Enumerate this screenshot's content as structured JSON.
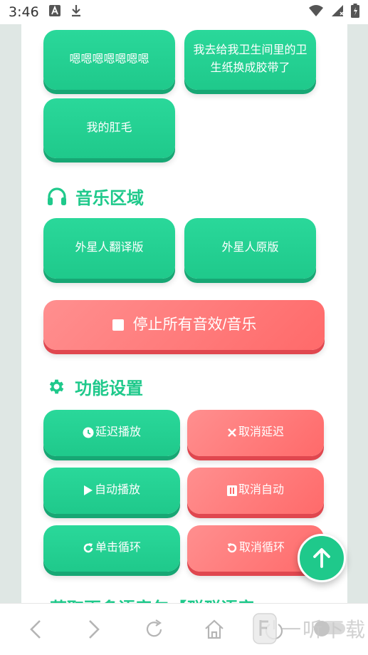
{
  "status_bar": {
    "time": "3:46"
  },
  "top_buttons": [
    {
      "label": "嗯嗯嗯嗯嗯嗯嗯"
    },
    {
      "label": "我去给我卫生间里的卫生纸换成胶带了"
    },
    {
      "label": "我的肛毛"
    }
  ],
  "music_section": {
    "title": "音乐区域",
    "icon": "headphones-icon",
    "buttons": [
      {
        "label": "外星人翻译版"
      },
      {
        "label": "外星人原版"
      }
    ],
    "stop_button": {
      "label": "停止所有音效/音乐",
      "icon": "stop-icon"
    }
  },
  "settings_section": {
    "title": "功能设置",
    "icon": "gear-icon",
    "buttons": [
      {
        "label": "延迟播放",
        "icon": "clock-icon"
      },
      {
        "label": "取消延迟",
        "icon": "close-icon"
      },
      {
        "label": "自动播放",
        "icon": "play-icon"
      },
      {
        "label": "取消自动",
        "icon": "pause-icon"
      },
      {
        "label": "单击循环",
        "icon": "redo-icon"
      },
      {
        "label": "取消循环",
        "icon": "undo-icon"
      }
    ]
  },
  "next_section_partial": {
    "title": "获取更多语音包【群群语音"
  },
  "watermark": {
    "text": "一听下载"
  },
  "colors": {
    "green": "#1fc98b",
    "red": "#ff6a6a"
  }
}
